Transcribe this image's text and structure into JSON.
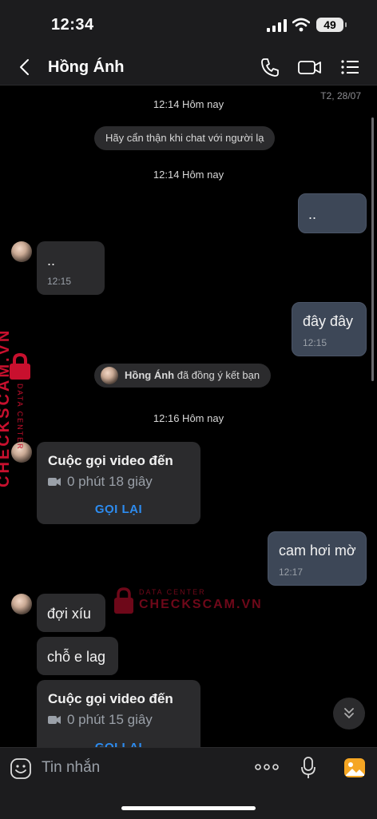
{
  "status": {
    "time": "12:34",
    "battery": "49"
  },
  "header": {
    "contact_name": "Hồng Ánh"
  },
  "chat": {
    "date_corner": "T2, 28/07",
    "ts1": "12:14 Hôm nay",
    "system_warning": "Hãy cẩn thận khi chat với người lạ",
    "ts2": "12:14 Hôm nay",
    "out1": "..",
    "in1": {
      "text": "..",
      "time": "12:15"
    },
    "out2": {
      "text": "đây đây",
      "time": "12:15"
    },
    "friend_notice": {
      "name": "Hồng Ánh",
      "text": "đã đồng ý kết bạn"
    },
    "ts3": "12:16 Hôm nay",
    "call1": {
      "title": "Cuộc gọi video đến",
      "duration": "0 phút 18 giây",
      "button": "GỌI LẠI"
    },
    "out3": {
      "text": "cam hơi mờ",
      "time": "12:17"
    },
    "in2": "đợi xíu",
    "in3": "chỗ e lag",
    "call2": {
      "title": "Cuộc gọi video đến",
      "duration": "0 phút 15 giây",
      "button": "GỌI LẠI"
    }
  },
  "watermark": {
    "line1": "DATA CENTER",
    "line2": "CHECKSCAM.VN"
  },
  "input": {
    "placeholder": "Tin nhắn"
  },
  "icons": {
    "back": "chevron-left-icon",
    "phone": "phone-icon",
    "video": "video-camera-icon",
    "menu": "list-menu-icon",
    "emoji": "emoji-icon",
    "more": "more-dots-icon",
    "mic": "microphone-icon",
    "gallery": "image-gallery-icon",
    "scroll_down": "double-chevron-down-icon"
  },
  "colors": {
    "link_blue": "#2d8cf0",
    "outgoing_bubble": "#3d4757",
    "incoming_bubble": "#2b2b2d",
    "watermark_red": "#c8102e"
  }
}
